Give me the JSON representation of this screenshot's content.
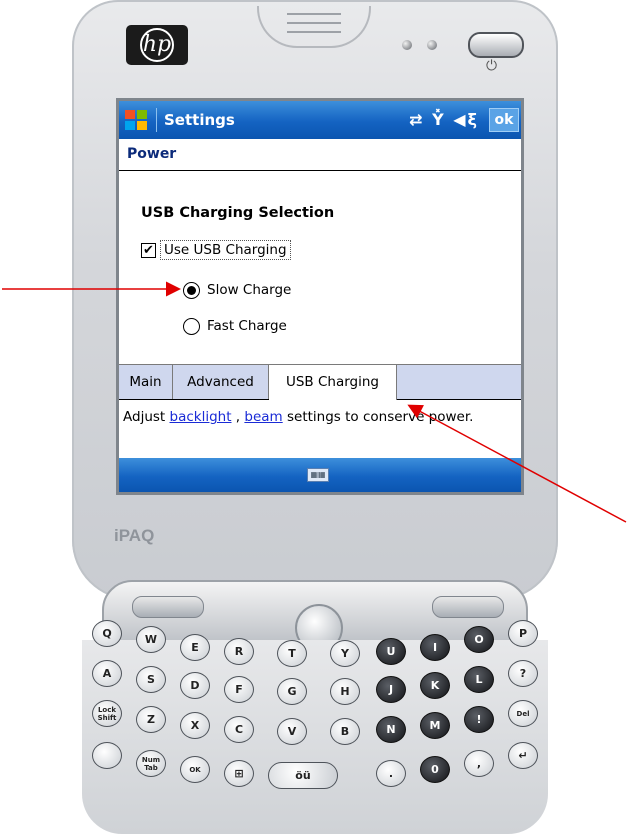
{
  "device": {
    "brand_logo": "hp",
    "model_label": "iPAQ",
    "power_glyph": "⏻"
  },
  "titlebar": {
    "title": "Settings",
    "status_icons": "⇄ Y̽ ◀ξ",
    "ok_label": "ok"
  },
  "page": {
    "section": "Power",
    "group_title": "USB Charging Selection",
    "checkbox": {
      "label": "Use USB Charging",
      "checked": true
    },
    "radios": [
      {
        "label": "Slow Charge",
        "selected": true
      },
      {
        "label": "Fast Charge",
        "selected": false
      }
    ]
  },
  "tabs": [
    {
      "label": "Main",
      "active": false
    },
    {
      "label": "Advanced",
      "active": false
    },
    {
      "label": "USB Charging",
      "active": true
    }
  ],
  "help": {
    "prefix": "Adjust ",
    "link1": "backlight",
    "mid": " , ",
    "link2": "beam",
    "suffix": "  settings to conserve power."
  },
  "keys": {
    "row1": [
      "Q",
      "W",
      "E",
      "R",
      "T",
      "Y",
      "U",
      "I",
      "O",
      "P"
    ],
    "row1_sub": [
      "",
      "",
      "$",
      "%",
      "",
      "",
      "1",
      "2",
      "3",
      "/"
    ],
    "row2": [
      "A",
      "S",
      "D",
      "F",
      "G",
      "H",
      "J",
      "K",
      "L",
      "?"
    ],
    "row2_sub": [
      "(",
      ")",
      "",
      "=",
      "+",
      "*",
      "4",
      "5",
      "6",
      "\""
    ],
    "row3": [
      "Lock Shift",
      "Z",
      "X",
      "C",
      "V",
      "B",
      "N",
      "M",
      "!",
      "Del"
    ],
    "row3_sub": [
      "",
      "&",
      ":",
      "@",
      "#",
      "",
      "7",
      "8",
      "9",
      ""
    ],
    "row4": [
      "",
      "Num Tab",
      "OK",
      "",
      "öü",
      "",
      ".",
      "0",
      ",",
      ""
    ]
  },
  "colors": {
    "titlebar_blue": "#1463c2",
    "tab_bg": "#cfd7ee",
    "link": "#1a2bd6",
    "annotation_red": "#e00000"
  }
}
